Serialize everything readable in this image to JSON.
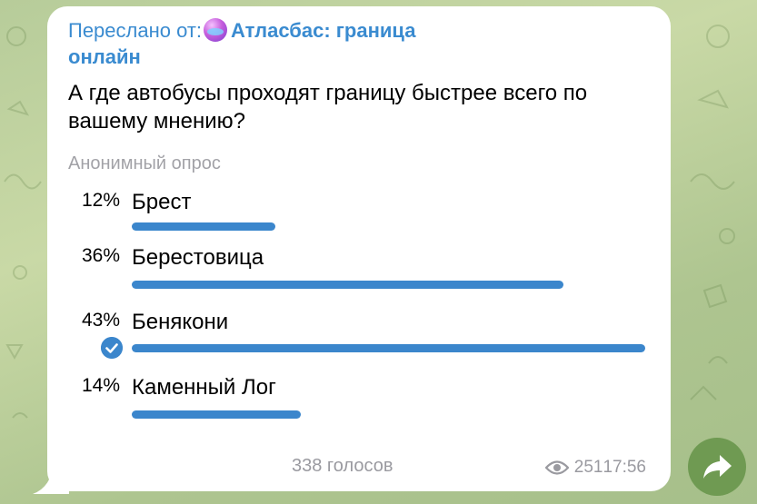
{
  "message": {
    "forwarded_prefix": "Переслано от:",
    "channel_name": "Атласбас: граница онлайн",
    "question": "А где автобусы проходят границу быстрее всего по вашему мнению?",
    "poll_type": "Анонимный опрос",
    "options": [
      {
        "percent": "12%",
        "label": "Брест",
        "share": 0.12,
        "bar_fraction": 0.28,
        "chosen": false
      },
      {
        "percent": "36%",
        "label": "Берестовица",
        "share": 0.36,
        "bar_fraction": 0.84,
        "chosen": false
      },
      {
        "percent": "43%",
        "label": "Бенякони",
        "share": 0.43,
        "bar_fraction": 1.0,
        "chosen": true
      },
      {
        "percent": "14%",
        "label": "Каменный Лог",
        "share": 0.14,
        "bar_fraction": 0.33,
        "chosen": false
      }
    ],
    "votes": "338 голосов",
    "views": "251",
    "time": "17:56"
  },
  "colors": {
    "accent": "#3b86cc",
    "forward_link": "#3a8bd0",
    "secondary_text": "#9a9aa0",
    "forward_button": "#6f9a52"
  },
  "icons": {
    "chosen": "check-icon",
    "views": "eye-icon",
    "share": "share-arrow-icon",
    "channel": "channel-avatar"
  }
}
